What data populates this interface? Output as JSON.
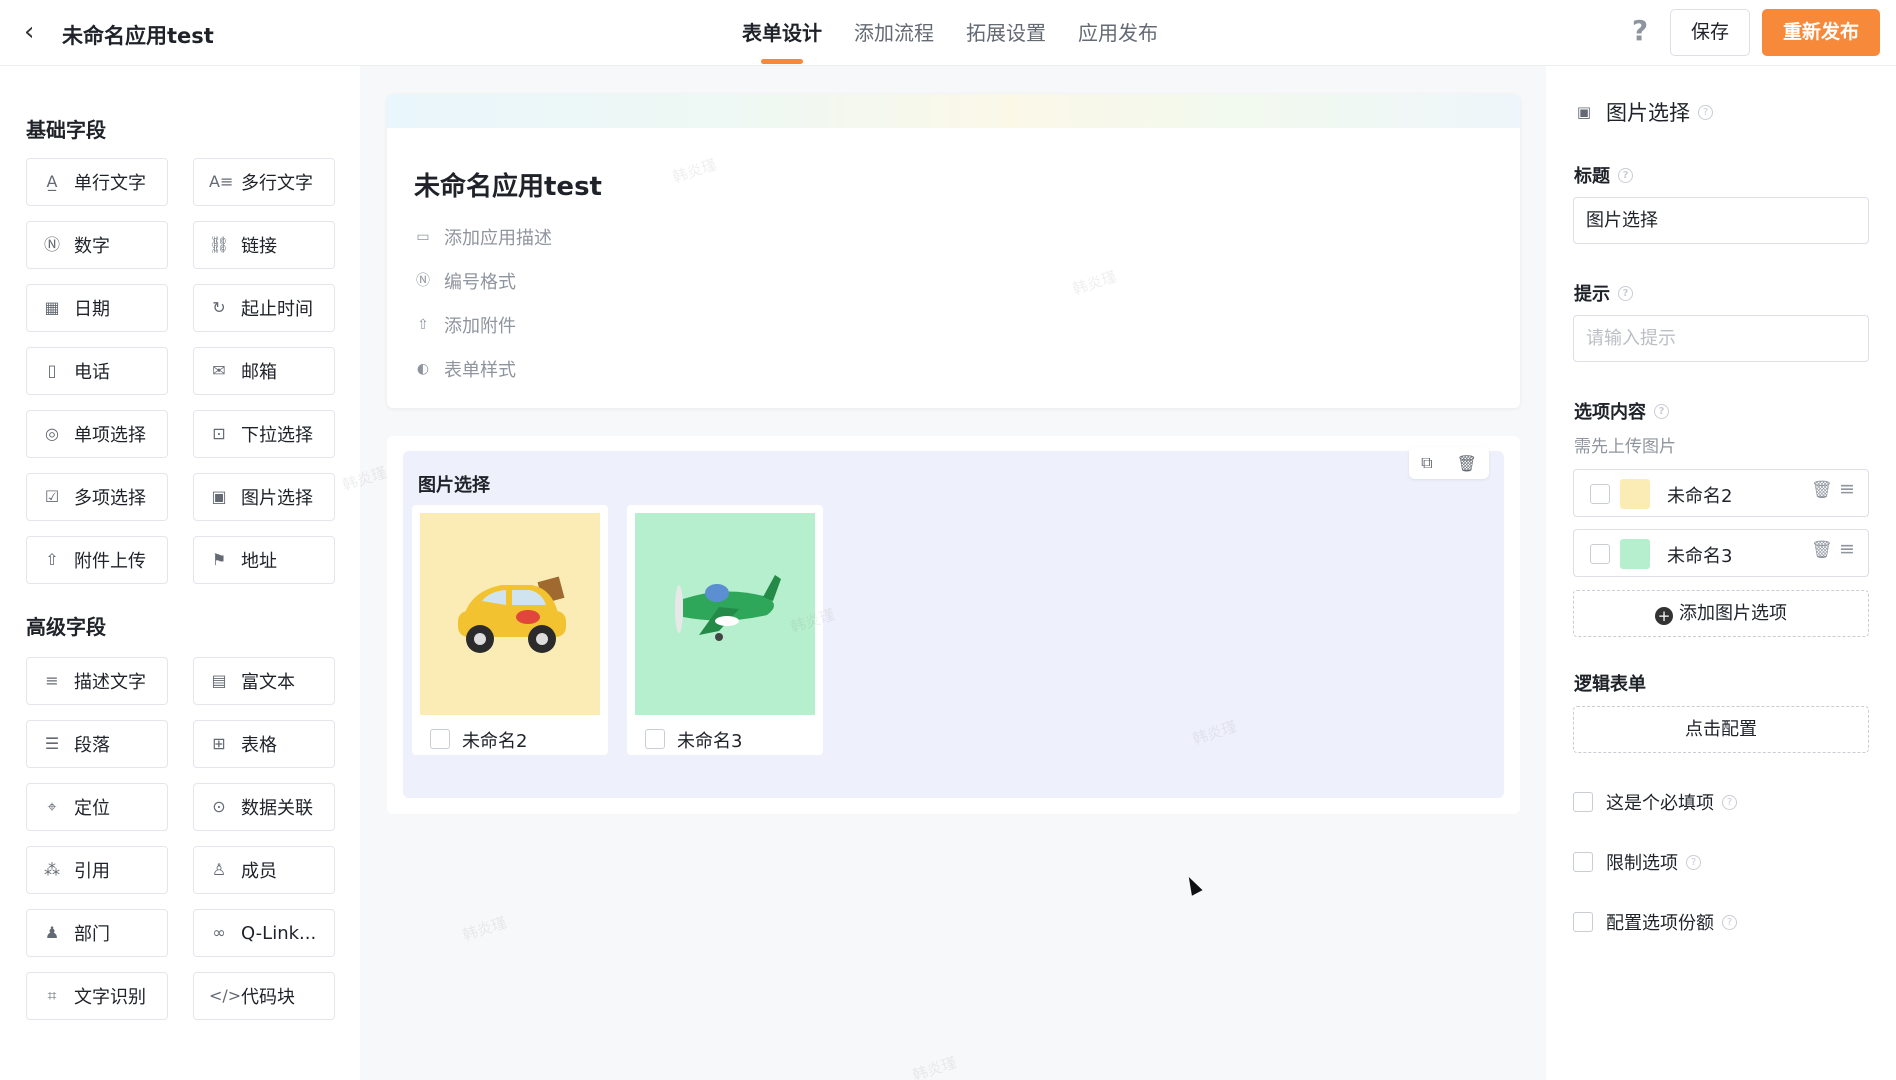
{
  "header": {
    "back_icon": "chevron-left-icon",
    "title": "未命名应用test",
    "tabs": [
      {
        "label": "表单设计",
        "active": true
      },
      {
        "label": "添加流程",
        "active": false
      },
      {
        "label": "拓展设置",
        "active": false
      },
      {
        "label": "应用发布",
        "active": false
      }
    ],
    "help_icon": "question-icon",
    "save_label": "保存",
    "publish_label": "重新发布"
  },
  "left_panel": {
    "basic_title": "基础字段",
    "basic_fields": [
      {
        "label": "单行文字",
        "icon": "text-line-icon"
      },
      {
        "label": "多行文字",
        "icon": "text-multiline-icon"
      },
      {
        "label": "数字",
        "icon": "number-icon"
      },
      {
        "label": "链接",
        "icon": "link-icon"
      },
      {
        "label": "日期",
        "icon": "calendar-icon"
      },
      {
        "label": "起止时间",
        "icon": "time-range-icon"
      },
      {
        "label": "电话",
        "icon": "phone-icon"
      },
      {
        "label": "邮箱",
        "icon": "mail-icon"
      },
      {
        "label": "单项选择",
        "icon": "radio-icon"
      },
      {
        "label": "下拉选择",
        "icon": "dropdown-icon"
      },
      {
        "label": "多项选择",
        "icon": "checkbox-icon"
      },
      {
        "label": "图片选择",
        "icon": "image-icon"
      },
      {
        "label": "附件上传",
        "icon": "upload-icon"
      },
      {
        "label": "地址",
        "icon": "location-icon"
      }
    ],
    "advanced_title": "高级字段",
    "advanced_fields": [
      {
        "label": "描述文字",
        "icon": "description-icon"
      },
      {
        "label": "富文本",
        "icon": "rich-text-icon"
      },
      {
        "label": "段落",
        "icon": "paragraph-icon"
      },
      {
        "label": "表格",
        "icon": "table-icon"
      },
      {
        "label": "定位",
        "icon": "pin-icon"
      },
      {
        "label": "数据关联",
        "icon": "data-link-icon"
      },
      {
        "label": "引用",
        "icon": "reference-icon"
      },
      {
        "label": "成员",
        "icon": "member-icon"
      },
      {
        "label": "部门",
        "icon": "department-icon"
      },
      {
        "label": "Q-Link...",
        "icon": "qlink-icon"
      },
      {
        "label": "文字识别",
        "icon": "ocr-icon"
      },
      {
        "label": "代码块",
        "icon": "code-icon"
      }
    ]
  },
  "canvas": {
    "form_title": "未命名应用test",
    "meta": [
      {
        "label": "添加应用描述",
        "icon": "comment-icon"
      },
      {
        "label": "编号格式",
        "icon": "number-format-icon"
      },
      {
        "label": "添加附件",
        "icon": "attachment-upload-icon"
      },
      {
        "label": "表单样式",
        "icon": "palette-icon"
      }
    ],
    "field": {
      "label": "图片选择",
      "copy_icon": "copy-icon",
      "delete_icon": "trash-icon",
      "options": [
        {
          "name": "未命名2",
          "image": "yellow-car-illustration",
          "bg": "#faecb4"
        },
        {
          "name": "未命名3",
          "image": "green-plane-illustration",
          "bg": "#b5efcd"
        }
      ]
    },
    "watermark": "韩炎瑾"
  },
  "right_panel": {
    "header": "图片选择",
    "header_icon": "image-icon",
    "title_label": "标题",
    "title_value": "图片选择",
    "hint_label": "提示",
    "hint_placeholder": "请输入提示",
    "options_label": "选项内容",
    "options_hint": "需先上传图片",
    "options": [
      {
        "name": "未命名2",
        "thumb_bg": "#faecb4"
      },
      {
        "name": "未命名3",
        "thumb_bg": "#b5efcd"
      }
    ],
    "add_option_label": "添加图片选项",
    "logic_label": "逻辑表单",
    "logic_button": "点击配置",
    "checks": [
      {
        "label": "这是个必填项"
      },
      {
        "label": "限制选项"
      },
      {
        "label": "配置选项份额"
      }
    ]
  },
  "colors": {
    "accent": "#f7893a",
    "field_bg": "#eef0fc"
  }
}
